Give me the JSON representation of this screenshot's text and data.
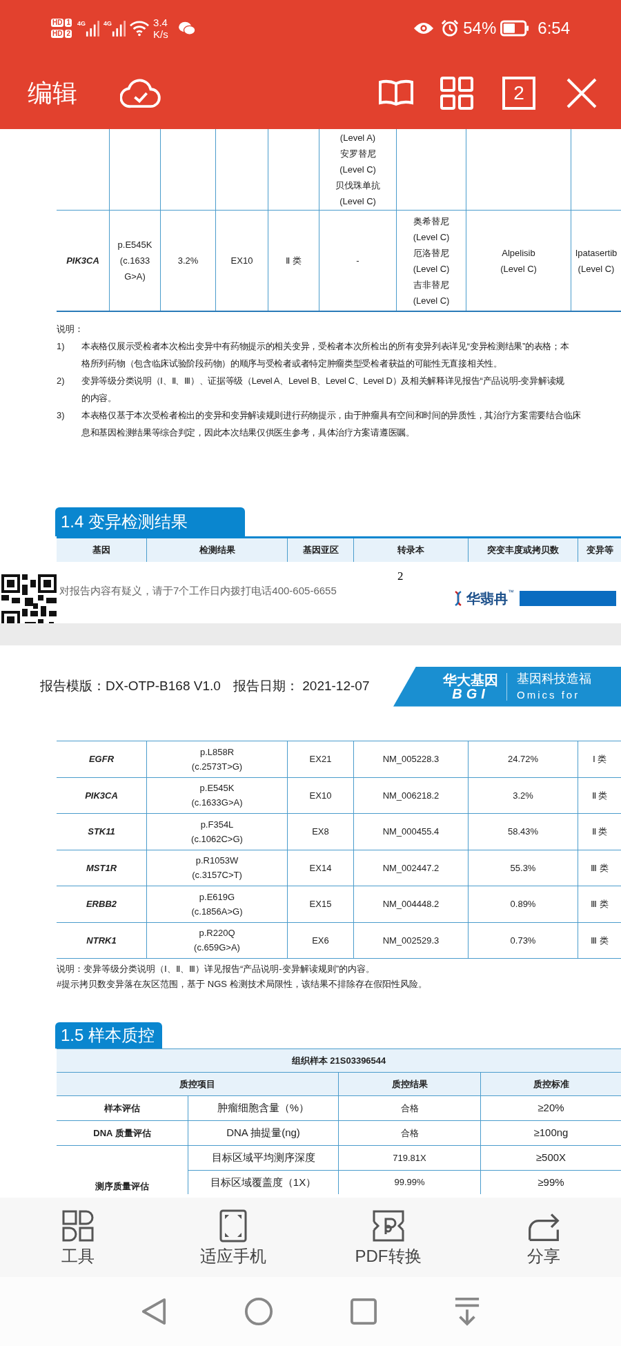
{
  "status_bar": {
    "sims": [
      {
        "label": "HD",
        "slot": "1"
      },
      {
        "label": "HD",
        "slot": "2"
      }
    ],
    "networks": [
      "4G",
      "4G"
    ],
    "speed": [
      "3.4",
      "K/s"
    ],
    "battery": "54%",
    "time": "6:54"
  },
  "toolbar": {
    "title": "编辑",
    "page_count": "2"
  },
  "drug_table": {
    "rows": [
      {
        "cells": {
          "column_6": [
            "(Level A)",
            "安罗替尼",
            "(Level C)",
            "贝伐珠单抗",
            "(Level C)"
          ]
        }
      },
      {
        "cells": {
          "column_1": [
            "PIK3CA"
          ],
          "column_2": [
            "p.E545K",
            "(c.1633",
            "G>A)"
          ],
          "column_3": [
            "3.2%"
          ],
          "column_4": [
            "EX10"
          ],
          "column_5": [
            "Ⅱ 类"
          ],
          "column_6": [
            "-"
          ],
          "column_7": [
            "奥希替尼",
            "(Level C)",
            "厄洛替尼",
            "(Level C)",
            "吉非替尼",
            "(Level C)"
          ],
          "column_8": [
            "Alpelisib",
            "(Level C)"
          ],
          "column_9": [
            "Ipatasertib",
            "(Level C)"
          ]
        }
      }
    ]
  },
  "notes": {
    "title": "说明：",
    "items": [
      {
        "number": "1)",
        "lines": [
          "本表格仅展示受检者本次检出变异中有药物提示的相关变异，受检者本次所检出的所有变异列表详见“变异检测结果”的表格；本",
          "格所列药物（包含临床试验阶段药物）的顺序与受检者或者特定肿瘤类型受检者获益的可能性无直接相关性。"
        ]
      },
      {
        "number": "2)",
        "lines": [
          "变异等级分类说明（Ⅰ、Ⅱ、Ⅲ）、证据等级（Level A、Level B、Level C、Level D）及相关解释详见报告“产品说明-变异解读规",
          "的内容。"
        ]
      },
      {
        "number": "3)",
        "lines": [
          "本表格仅基于本次受检者检出的变异和变异解读规则进行药物提示，由于肿瘤具有空间和时间的异质性，其治疗方案需要结合临床",
          "息和基因检测结果等综合判定，因此本次结果仅供医生参考，具体治疗方案请遵医嘱。"
        ]
      }
    ]
  },
  "section_1_4": {
    "title": "1.4 变异检测结果",
    "columns": [
      "基因",
      "检测结果",
      "基因亚区",
      "转录本",
      "突变丰度或拷贝数",
      "变异等"
    ]
  },
  "footer": {
    "page_number": "2",
    "contact": "对报告内容有疑义，请于7个工作日内拨打电话400-605-6655",
    "logo": "华翡冉",
    "trademark": "™"
  },
  "page2_header": {
    "template": "报告模版：DX-OTP-B168 V1.0",
    "date": "报告日期： 2021-12-07",
    "brand": "华大基因",
    "brand_latin": "BGI",
    "slogan": "基因科技造福",
    "slogan_latin": "Omics for"
  },
  "variant_table": {
    "rows": [
      {
        "gene": "EGFR",
        "protein": "p.L858R",
        "cdna": "(c.2573T>G)",
        "exon": "EX21",
        "transcript": "NM_005228.3",
        "abundance": "24.72%",
        "class": "Ⅰ 类"
      },
      {
        "gene": "PIK3CA",
        "protein": "p.E545K",
        "cdna": "(c.1633G>A)",
        "exon": "EX10",
        "transcript": "NM_006218.2",
        "abundance": "3.2%",
        "class": "Ⅱ 类"
      },
      {
        "gene": "STK11",
        "protein": "p.F354L",
        "cdna": "(c.1062C>G)",
        "exon": "EX8",
        "transcript": "NM_000455.4",
        "abundance": "58.43%",
        "class": "Ⅱ 类"
      },
      {
        "gene": "MST1R",
        "protein": "p.R1053W",
        "cdna": "(c.3157C>T)",
        "exon": "EX14",
        "transcript": "NM_002447.2",
        "abundance": "55.3%",
        "class": "Ⅲ 类"
      },
      {
        "gene": "ERBB2",
        "protein": "p.E619G",
        "cdna": "(c.1856A>G)",
        "exon": "EX15",
        "transcript": "NM_004448.2",
        "abundance": "0.89%",
        "class": "Ⅲ 类"
      },
      {
        "gene": "NTRK1",
        "protein": "p.R220Q",
        "cdna": "(c.659G>A)",
        "exon": "EX6",
        "transcript": "NM_002529.3",
        "abundance": "0.73%",
        "class": "Ⅲ 类"
      }
    ]
  },
  "variant_notes": [
    "说明：变异等级分类说明（Ⅰ、Ⅱ、Ⅲ）详见报告“产品说明-变异解读规则”的内容。",
    "#提示拷贝数变异落在灰区范围，基于 NGS 检测技术局限性，该结果不排除存在假阳性风险。"
  ],
  "section_1_5": {
    "title": "1.5 样本质控",
    "sample": "组织样本 21S03396544",
    "columns": [
      "质控项目",
      "质控结果",
      "质控标准"
    ],
    "groups": [
      {
        "label": "样本评估",
        "rows": [
          {
            "item": "肿瘤细胞含量（%）",
            "result": "合格",
            "standard": "≥20%"
          }
        ]
      },
      {
        "label": "DNA 质量评估",
        "rows": [
          {
            "item": "DNA 抽提量(ng)",
            "result": "合格",
            "standard": "≥100ng"
          }
        ]
      },
      {
        "label": "测序质量评估",
        "rows": [
          {
            "item": "目标区域平均测序深度",
            "result": "719.81X",
            "standard": "≥500X"
          },
          {
            "item": "目标区域覆盖度（1X）",
            "result": "99.99%",
            "standard": "≥99%"
          }
        ]
      }
    ]
  },
  "bottom_toolbar": {
    "items": [
      {
        "kind": "tools",
        "label": "工具"
      },
      {
        "kind": "fit",
        "label": "适应手机"
      },
      {
        "kind": "pdf",
        "label": "PDF转换"
      },
      {
        "kind": "share",
        "label": "分享"
      }
    ]
  }
}
